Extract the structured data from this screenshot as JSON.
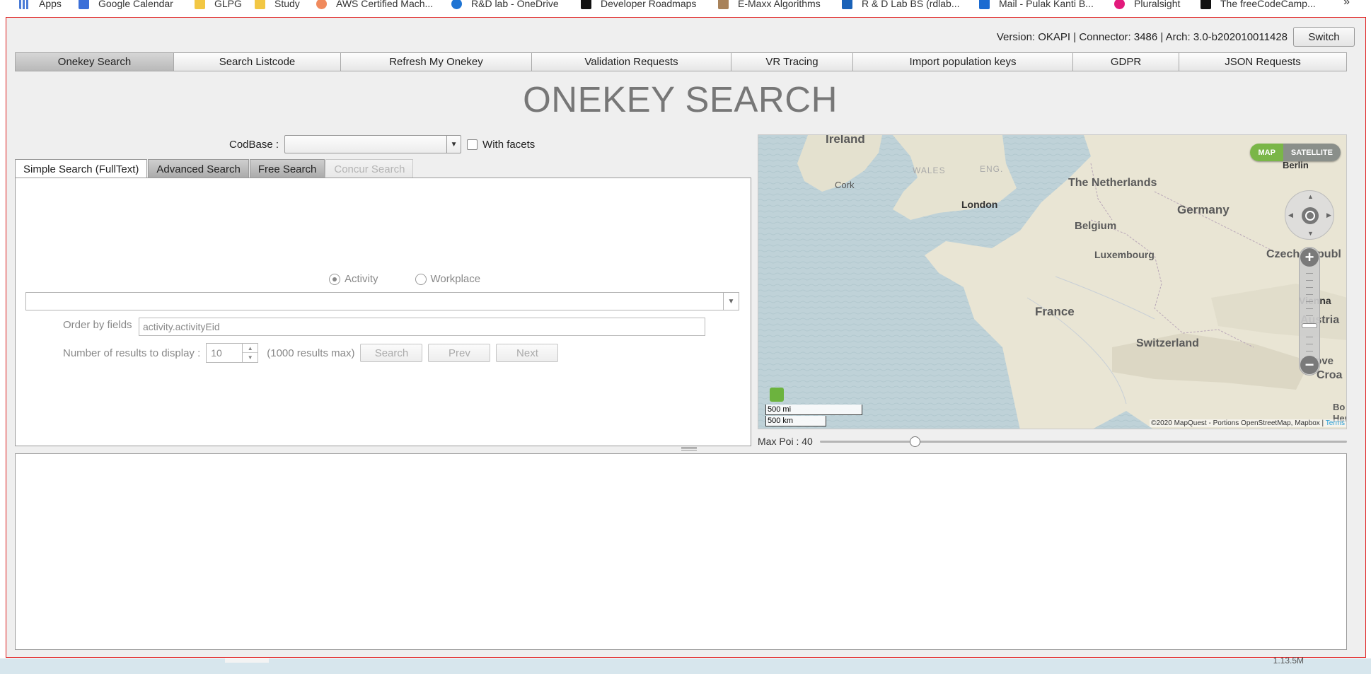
{
  "bookmarks": {
    "items": [
      {
        "label": "Apps",
        "icon": "apps-grid-icon",
        "color": "#4a7bd6"
      },
      {
        "label": "Google Calendar",
        "icon": "calendar-icon",
        "color": "#3b6fd8"
      },
      {
        "label": "GLPG",
        "icon": "folder-icon",
        "color": "#f2c744"
      },
      {
        "label": "Study",
        "icon": "folder-icon",
        "color": "#f2c744"
      },
      {
        "label": "AWS Certified Mach...",
        "icon": "cloud-icon",
        "color": "#f08a5d"
      },
      {
        "label": "R&D lab - OneDrive",
        "icon": "onedrive-icon",
        "color": "#1f74d3"
      },
      {
        "label": "Developer Roadmaps",
        "icon": "roadmap-icon",
        "color": "#111111"
      },
      {
        "label": "E-Maxx Algorithms",
        "icon": "emaxx-icon",
        "color": "#a8825a"
      },
      {
        "label": "R & D Lab BS (rdlab...",
        "icon": "trello-icon",
        "color": "#1a62b8"
      },
      {
        "label": "Mail - Pulak Kanti B...",
        "icon": "outlook-icon",
        "color": "#1a6ad1"
      },
      {
        "label": "Pluralsight",
        "icon": "pluralsight-icon",
        "color": "#e2197b"
      },
      {
        "label": "The freeCodeCamp...",
        "icon": "freecodecamp-icon",
        "color": "#111111"
      }
    ],
    "more": "»"
  },
  "header": {
    "version_text": "Version: OKAPI | Connector: 3486 | Arch: 3.0-b202010011428",
    "switch_label": "Switch"
  },
  "nav": [
    {
      "label": "Onekey Search",
      "active": true
    },
    {
      "label": "Search Listcode"
    },
    {
      "label": "Refresh My Onekey"
    },
    {
      "label": "Validation Requests"
    },
    {
      "label": "VR Tracing"
    },
    {
      "label": "Import population keys"
    },
    {
      "label": "GDPR"
    },
    {
      "label": "JSON Requests"
    }
  ],
  "page_title": "ONEKEY SEARCH",
  "codbase": {
    "label": "CodBase :",
    "value": "",
    "facets_label": "With facets",
    "facets_checked": false
  },
  "tabs": [
    {
      "label": "Simple Search (FullText)",
      "state": "active"
    },
    {
      "label": "Advanced Search",
      "state": "normal"
    },
    {
      "label": "Free Search",
      "state": "normal"
    },
    {
      "label": "Concur Search",
      "state": "disabled"
    }
  ],
  "search": {
    "radio_activity": "Activity",
    "radio_workplace": "Workplace",
    "selected_radio": "Activity",
    "query_value": "",
    "order_label": "Order by fields",
    "order_value": "activity.activityEid",
    "results_label": "Number of results to display :",
    "results_value": "10",
    "results_max": "(1000 results max)",
    "search_button": "Search",
    "prev_button": "Prev",
    "next_button": "Next"
  },
  "map": {
    "map_button": "MAP",
    "satellite_button": "SATELLITE",
    "scale_mi": "500 mi",
    "scale_km": "500 km",
    "attribution": "©2020 MapQuest - Portions OpenStreetMap, Mapbox |",
    "terms": "Terms",
    "labels": {
      "ireland": "Ireland",
      "wales": "WALES",
      "eng": "ENG.",
      "cork": "Cork",
      "london": "London",
      "netherlands": "The Netherlands",
      "germany": "Germany",
      "belgium": "Belgium",
      "luxembourg": "Luxembourg",
      "czech": "Czech Republ",
      "france": "France",
      "switzerland": "Switzerland",
      "austria": "Austria",
      "vienna": "Vienna",
      "slovenia": "Slove",
      "croatia": "Croa",
      "berlin": "Berlin",
      "bo": "Bo",
      "her": "Her"
    },
    "colors": {
      "sea": "#bcd0d6",
      "land": "#e7e3d3",
      "accent": "#7ab648"
    }
  },
  "max_poi": {
    "label": "Max Poi : 40",
    "value": 40,
    "fraction": 0.18
  },
  "status_strip": {
    "text": "1.13.5M"
  }
}
